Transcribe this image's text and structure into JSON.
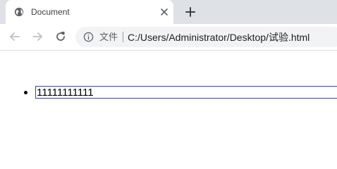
{
  "browser": {
    "tab": {
      "title": "Document",
      "favicon_icon": "globe-icon",
      "close_icon": "close-icon"
    },
    "new_tab_icon": "plus-icon",
    "toolbar": {
      "back_icon": "arrow-left-icon",
      "forward_icon": "arrow-right-icon",
      "reload_icon": "reload-icon"
    },
    "omnibox": {
      "info_icon": "info-icon",
      "scheme_label": "文件",
      "url": "C:/Users/Administrator/Desktop/试验.html"
    }
  },
  "page": {
    "list": {
      "items": [
        {
          "input_value": "11111111111"
        }
      ]
    }
  },
  "colors": {
    "tabstrip_bg": "#dee1e6",
    "omnibox_bg": "#f1f3f4",
    "input_border": "#3e4394"
  }
}
